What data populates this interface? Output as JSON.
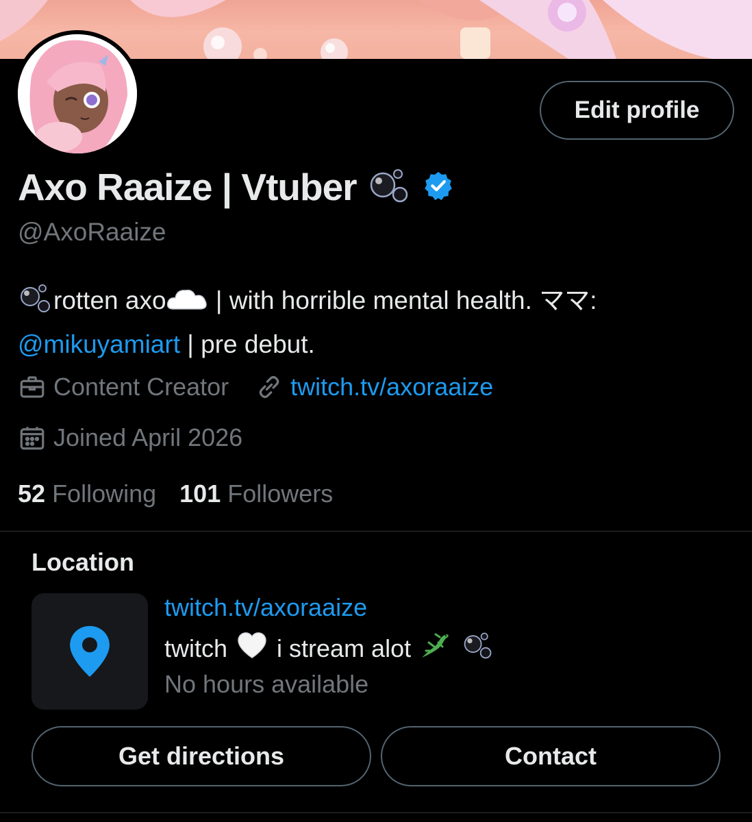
{
  "profile": {
    "display_name": "Axo Raaize | Vtuber",
    "handle": "@AxoRaaize",
    "edit_label": "Edit profile",
    "verified": true,
    "accent": "#1d9bf0"
  },
  "bio": {
    "part1": "rotten axo",
    "part2": " | with horrible mental health. ママ:",
    "mention": "@mikuyamiart",
    "part3": " | pre debut."
  },
  "meta": {
    "category": "Content Creator",
    "category_icon": "briefcase-icon",
    "website": "twitch.tv/axoraaize",
    "website_icon": "link-icon",
    "joined": "Joined April 2026",
    "joined_icon": "calendar-icon"
  },
  "stats": {
    "following_count": "52",
    "following_label": "Following",
    "followers_count": "101",
    "followers_label": "Followers"
  },
  "location": {
    "title": "Location",
    "link": "twitch.tv/axoraaize",
    "description_a": "twitch",
    "description_b": "i stream alot",
    "hours": "No hours available",
    "pin_icon": "map-pin-icon",
    "directions_label": "Get directions",
    "contact_label": "Contact"
  },
  "colors": {
    "background": "#000000",
    "text_primary": "#e7e9ea",
    "text_secondary": "#71767b",
    "link": "#1d9bf0",
    "border": "#536471"
  }
}
